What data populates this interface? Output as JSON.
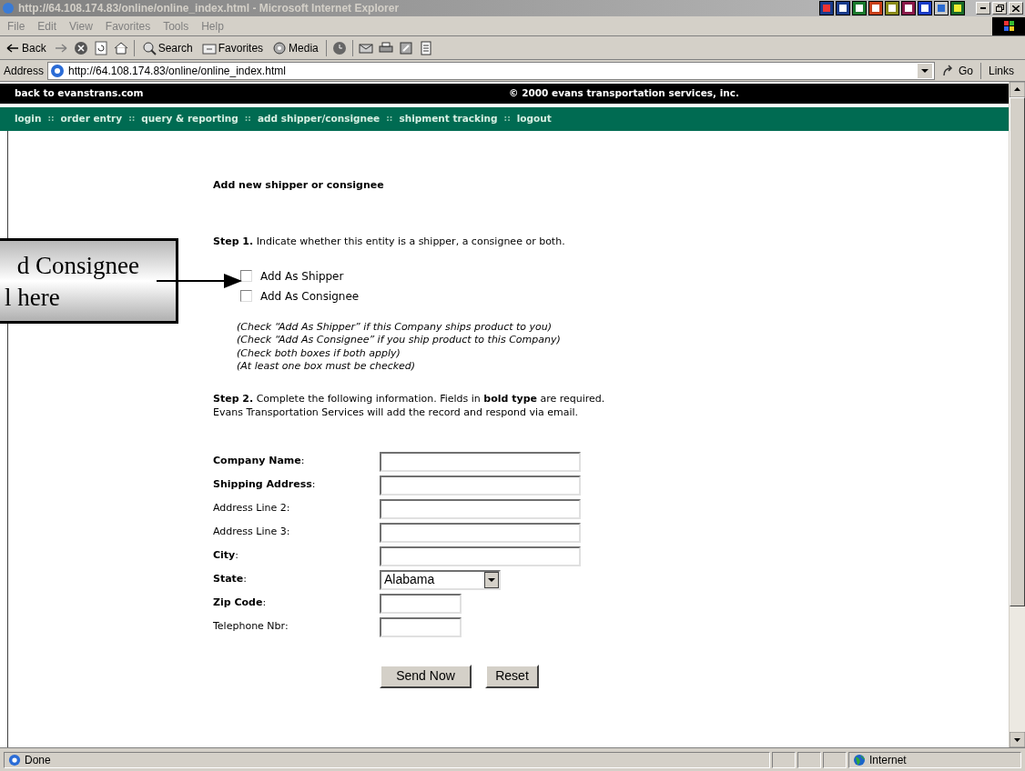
{
  "window": {
    "title": "http://64.108.174.83/online/online_index.html - Microsoft Internet Explorer"
  },
  "menu": [
    "File",
    "Edit",
    "View",
    "Favorites",
    "Tools",
    "Help"
  ],
  "toolbar": [
    {
      "kind": "back",
      "label": "Back"
    },
    {
      "kind": "forward"
    },
    {
      "kind": "stop"
    },
    {
      "kind": "refresh"
    },
    {
      "kind": "home"
    },
    {
      "kind": "search",
      "label": "Search"
    },
    {
      "kind": "favorites",
      "label": "Favorites"
    },
    {
      "kind": "media",
      "label": "Media"
    },
    {
      "kind": "history"
    },
    {
      "kind": "mail"
    },
    {
      "kind": "print"
    },
    {
      "kind": "edit"
    },
    {
      "kind": "discuss"
    }
  ],
  "address_bar": {
    "label": "Address",
    "url": "http://64.108.174.83/online/online_index.html",
    "go": "Go",
    "links": "Links"
  },
  "site_header": {
    "left": "back to evanstrans.com",
    "right": "© 2000 evans transportation services, inc."
  },
  "nav": {
    "separator": "::",
    "items": [
      "login",
      "order entry",
      "query & reporting",
      "add shipper/consignee",
      "shipment tracking",
      "logout"
    ]
  },
  "page_title": "Add new shipper or consignee",
  "step1": "**Step 1.** Indicate whether this entity is a shipper, a consignee or both.",
  "checkboxes": [
    {
      "label": "Add As Shipper",
      "checked": false
    },
    {
      "label": "Add As Consignee",
      "checked": false
    }
  ],
  "notes": [
    "(Check “Add As Shipper” if this Company ships product to you)",
    "(Check “Add As Consignee” if you ship product to this Company)",
    "(Check both boxes if both apply)",
    "(At least one box must be checked)"
  ],
  "step2": [
    "**Step 2.** Complete the following information. Fields in **bold type** are required.",
    "Evans Transportation Services will add the record and respond via email."
  ],
  "fields": [
    {
      "label": "**Company Name**:",
      "kind": "long"
    },
    {
      "label": "**Shipping Address**:",
      "kind": "long"
    },
    {
      "label": "Address Line 2:",
      "kind": "long"
    },
    {
      "label": "Address Line 3:",
      "kind": "long"
    },
    {
      "label": "**City**:",
      "kind": "long"
    },
    {
      "label": "**State**:",
      "kind": "select",
      "value": "Alabama"
    },
    {
      "label": "**Zip Code**:",
      "kind": "short"
    },
    {
      "label": "Telephone Nbr:",
      "kind": "short"
    }
  ],
  "buttons": [
    "Send Now",
    "Reset"
  ],
  "callout": [
    "d Consignee",
    "l here"
  ],
  "status_bar": {
    "text": "Done",
    "zone": "Internet"
  }
}
